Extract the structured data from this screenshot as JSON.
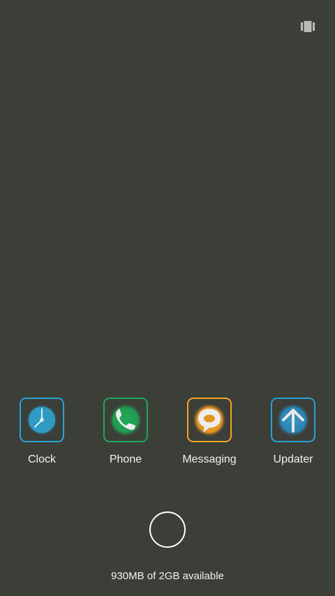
{
  "top_bar": {
    "action_icon": "recent-apps-icon",
    "icon_color": "#b9bbb6"
  },
  "apps": [
    {
      "label": "Clock",
      "icon": "clock-icon",
      "border_color": "#2aa3d8",
      "fill_color": "#2f90b8"
    },
    {
      "label": "Phone",
      "icon": "phone-icon",
      "border_color": "#21a55d",
      "fill_color": "#1f9a4f"
    },
    {
      "label": "Messaging",
      "icon": "message-icon",
      "border_color": "#f2a623",
      "fill_color": "#e39a25"
    },
    {
      "label": "Updater",
      "icon": "arrow-up-icon",
      "border_color": "#2a9fd6",
      "fill_color": "#2d86b8"
    }
  ],
  "home_button": {
    "icon": "home-circle-icon"
  },
  "memory_status": "930MB of 2GB available"
}
